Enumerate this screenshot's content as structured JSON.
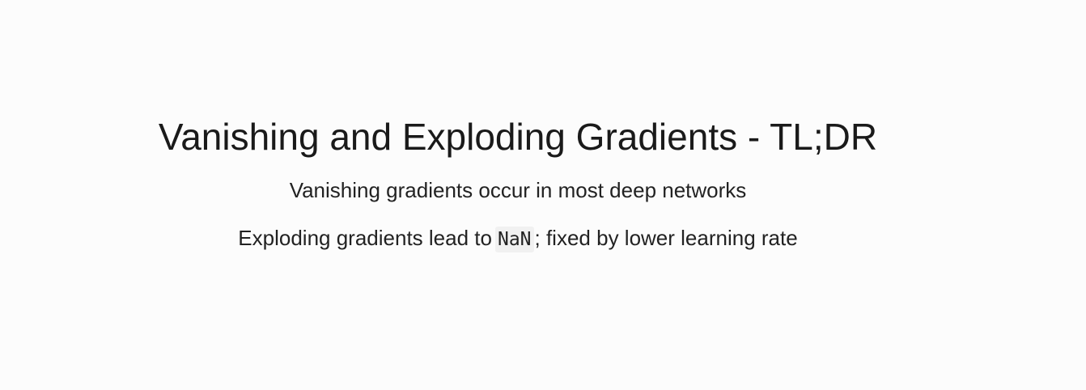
{
  "slide": {
    "title": "Vanishing and Exploding Gradients - TL;DR",
    "bullets": [
      {
        "text": "Vanishing gradients occur in most deep networks"
      },
      {
        "text_before": "Exploding gradients lead to",
        "code": "NaN",
        "text_after": "; fixed by lower learning rate"
      }
    ]
  },
  "colors": {
    "background": "#fcfcfc",
    "text": "#1c1c1c",
    "code_background": "#f1f1f1"
  }
}
